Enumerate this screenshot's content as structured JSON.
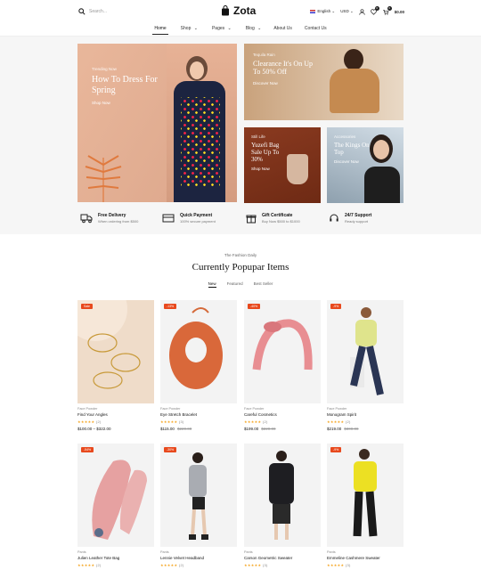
{
  "header": {
    "search_placeholder": "Search...",
    "logo": "Zota",
    "language": "English",
    "currency": "USD",
    "cart_total": "$0.00",
    "wishlist_count": "0",
    "cart_count": "0"
  },
  "nav": [
    "Home",
    "Shop",
    "Pages",
    "Blog",
    "About Us",
    "Contact Us"
  ],
  "banners": {
    "main": {
      "tag": "Trending Now",
      "title": "How To Dress For Spring",
      "cta": "Shop Now"
    },
    "top_right": {
      "tag": "Tequila Rain",
      "title": "Clearance It's On Up To 50% Off",
      "cta": "Discover Now"
    },
    "mid": {
      "tag": "Still Life",
      "title": "Yuzefi Bag Sale Up To 30%",
      "cta": "Shop Now"
    },
    "right": {
      "tag": "Accessories",
      "title": "The Kings On Top",
      "cta": "Discover Now"
    }
  },
  "features": [
    {
      "title": "Free Delivery",
      "sub": "When ordering from $500",
      "icon": "truck-icon"
    },
    {
      "title": "Quick Payment",
      "sub": "100% secure payment",
      "icon": "card-icon"
    },
    {
      "title": "Gift Certificate",
      "sub": "Buy Now $500 to $1000",
      "icon": "gift-icon"
    },
    {
      "title": "24/7 Support",
      "sub": "Ready support",
      "icon": "headset-icon"
    }
  ],
  "section": {
    "subtitle": "The Fashion Daily",
    "title": "Currently Popupar Items",
    "tabs": [
      "New",
      "Featured",
      "Best Seller"
    ]
  },
  "products": [
    {
      "badge": "Sale",
      "cat": "Face Powder",
      "name": "Find Your Angles",
      "stars": "★★★★★",
      "count": "(2)",
      "price": "$100.00 – $322.00",
      "old": ""
    },
    {
      "badge": "-13%",
      "cat": "Face Powder",
      "name": "Eye Stretch Bracelet",
      "stars": "★★★★★",
      "count": "(3)",
      "price": "$115.00",
      "old": "$220.00"
    },
    {
      "badge": "-40%",
      "cat": "Face Powder",
      "name": "Careful Cosmetics",
      "stars": "★★★★★",
      "count": "(2)",
      "price": "$199.00",
      "old": "$220.00"
    },
    {
      "badge": "-9%",
      "cat": "Face Powder",
      "name": "Monogram Spirit",
      "stars": "★★★★★",
      "count": "(2)",
      "price": "$219.00",
      "old": "$300.00"
    },
    {
      "badge": "-54%",
      "cat": "Pants",
      "name": "Julien Leather Tote Bag",
      "stars": "★★★★★",
      "count": "(2)",
      "price": "",
      "old": ""
    },
    {
      "badge": "-30%",
      "cat": "Pants",
      "name": "Lennie Velvet Headband",
      "stars": "★★★★★",
      "count": "(2)",
      "price": "",
      "old": ""
    },
    {
      "badge": "",
      "cat": "Pants",
      "name": "Carson Geometric Sweater",
      "stars": "★★★★★",
      "count": "(3)",
      "price": "",
      "old": ""
    },
    {
      "badge": "-9%",
      "cat": "Pants",
      "name": "Emmeline Cashmere Sweater",
      "stars": "★★★★★",
      "count": "(3)",
      "price": "",
      "old": ""
    }
  ],
  "colors": {
    "sale": "#e8491d",
    "star": "#f5a623"
  }
}
